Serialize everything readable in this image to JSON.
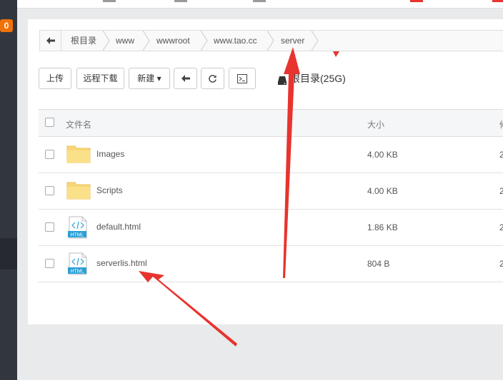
{
  "sidebar": {
    "badge": "0"
  },
  "breadcrumb": {
    "back_icon": "arrow-left-icon",
    "items": [
      "根目录",
      "www",
      "wwwroot",
      "www.tao.cc",
      "server"
    ]
  },
  "toolbar": {
    "upload": "上传",
    "remote_download": "远程下载",
    "new": "新建",
    "new_caret": "▾",
    "back_icon": "arrow-left-icon",
    "refresh_icon": "refresh-icon",
    "terminal_icon": "terminal-icon",
    "disk_label": "根目录(25G)"
  },
  "table": {
    "headers": {
      "name": "文件名",
      "size": "大小",
      "extra": "修"
    },
    "rows": [
      {
        "name": "Images",
        "size": "4.00 KB",
        "extra": "2",
        "icon": "folder-icon"
      },
      {
        "name": "Scripts",
        "size": "4.00 KB",
        "extra": "2",
        "icon": "folder-icon"
      },
      {
        "name": "default.html",
        "size": "1.86 KB",
        "extra": "2",
        "icon": "html-file-icon"
      },
      {
        "name": "serverlis.html",
        "size": "804 B",
        "extra": "2",
        "icon": "html-file-icon"
      }
    ],
    "html_badge": "HTML"
  },
  "colors": {
    "sidebar": "#32373f",
    "badge": "#f0720a",
    "folder": "#f8d775",
    "annotation_arrow": "#e8332e"
  }
}
